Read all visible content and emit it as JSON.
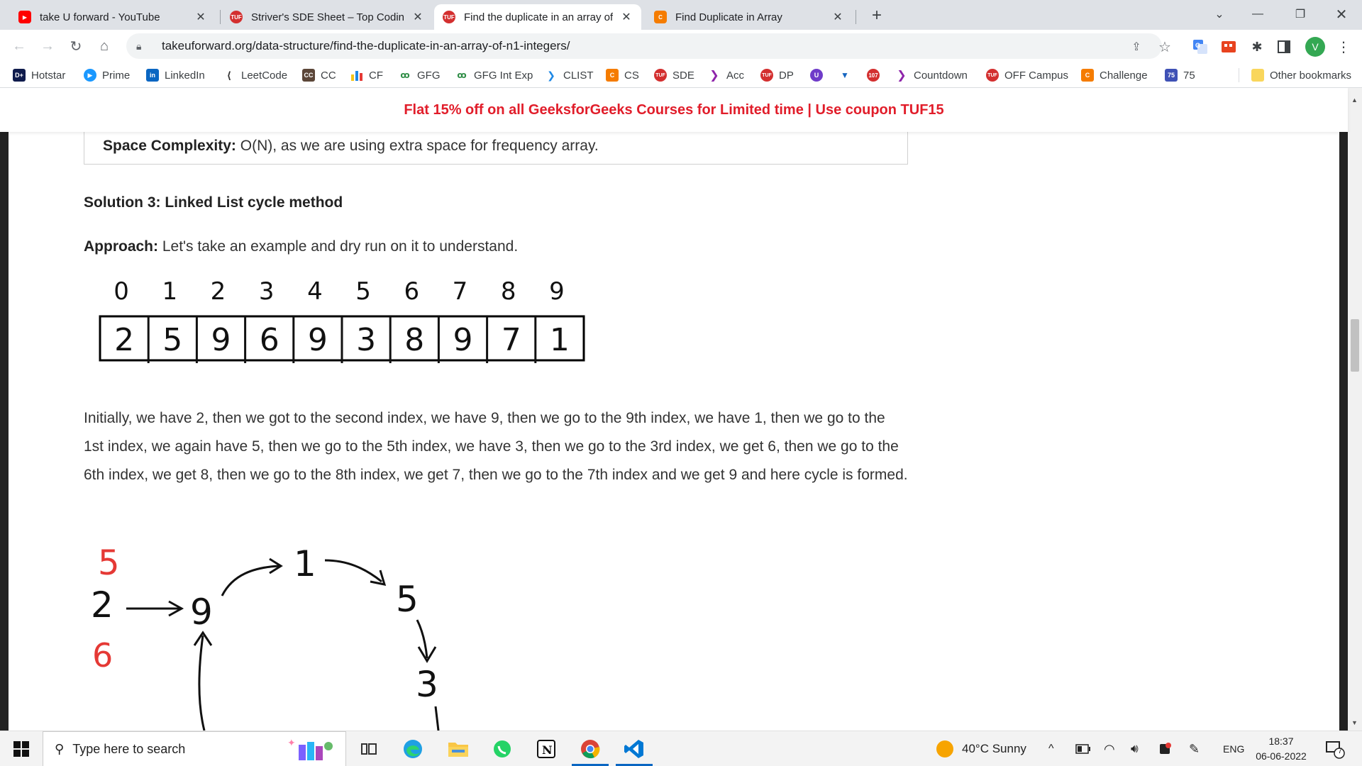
{
  "tabs": [
    {
      "title": "take U forward - YouTube",
      "active": false
    },
    {
      "title": "Striver's SDE Sheet – Top Coding",
      "active": false
    },
    {
      "title": "Find the duplicate in an array of N",
      "active": true
    },
    {
      "title": "Find Duplicate in Array",
      "active": false
    }
  ],
  "url": "takeuforward.org/data-structure/find-the-duplicate-in-an-array-of-n1-integers/",
  "profile_initial": "V",
  "bookmarks": [
    "Hotstar",
    "Prime",
    "LinkedIn",
    "LeetCode",
    "CC",
    "CF",
    "GFG",
    "GFG Int Exp",
    "CLIST",
    "CS",
    "SDE",
    "Acc",
    "DP",
    "Countdown",
    "OFF Campus",
    "Challenge",
    "75"
  ],
  "bookmark_badges": {
    "cf_badge": "107",
    "num_badge": "75",
    "cc_badge": "CC"
  },
  "other_bookmarks": "Other bookmarks",
  "promo_banner": "Flat 15% off on all GeeksforGeeks Courses for Limited time | Use coupon TUF15",
  "article": {
    "space_label": "Space Complexity:",
    "space_text": " O(N), as we are using extra space for frequency array.",
    "solution_title": "Solution 3: Linked List cycle method",
    "approach_label": "Approach:",
    "approach_text": " Let's take an example and dry run on it to understand.",
    "paragraph": "Initially, we have 2, then we got to the second index, we have 9, then we go to the 9th index, we have 1, then we go to the 1st index, we again have 5, then we go to the 5th index, we have 3, then we go to the 3rd index, we get 6, then we go to the 6th index, we get 8, then we go to the 8th index, we get 7, then we go to the 7th index and we get 9 and here cycle is formed."
  },
  "array_diagram": {
    "indices": [
      "0",
      "1",
      "2",
      "3",
      "4",
      "5",
      "6",
      "7",
      "8",
      "9"
    ],
    "values": [
      "2",
      "5",
      "9",
      "6",
      "9",
      "3",
      "8",
      "9",
      "7",
      "1"
    ]
  },
  "cycle_diagram": {
    "nodes": [
      "2",
      "9",
      "1",
      "5",
      "3"
    ],
    "red_marks": [
      "5",
      "6"
    ]
  },
  "taskbar": {
    "search_placeholder": "Type here to search",
    "weather": "40°C  Sunny",
    "language": "ENG",
    "time": "18:37",
    "date": "06-06-2022",
    "notification_count": "7"
  },
  "colors": {
    "promo_red": "#e11d2a",
    "tuf_red": "#d32f2f",
    "youtube_red": "#ff0000",
    "chrome_tab_bg": "#dee1e6"
  }
}
